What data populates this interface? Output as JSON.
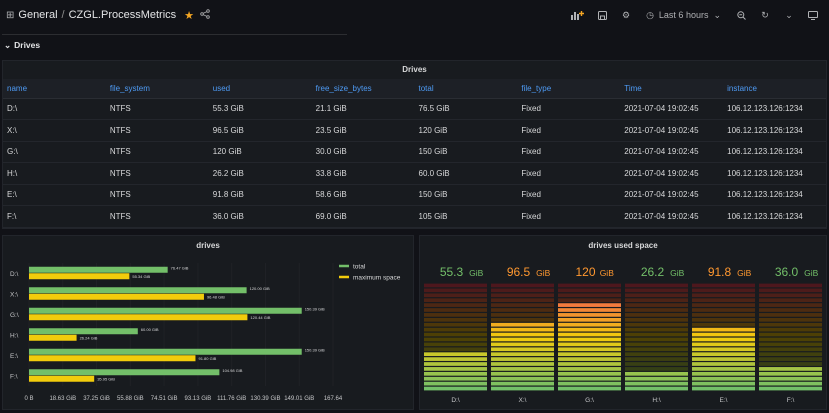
{
  "header": {
    "folder": "General",
    "separator": "/",
    "dashboard": "CZGL.ProcessMetrics",
    "time_range": "Last 6 hours"
  },
  "row": {
    "title": "Drives"
  },
  "table": {
    "title": "Drives",
    "columns": [
      "name",
      "file_system",
      "used",
      "free_size_bytes",
      "total",
      "file_type",
      "Time",
      "instance"
    ],
    "rows": [
      [
        "D:\\",
        "NTFS",
        "55.3 GiB",
        "21.1 GiB",
        "76.5 GiB",
        "Fixed",
        "2021-07-04 19:02:45",
        "106.12.123.126:1234"
      ],
      [
        "X:\\",
        "NTFS",
        "96.5 GiB",
        "23.5 GiB",
        "120 GiB",
        "Fixed",
        "2021-07-04 19:02:45",
        "106.12.123.126:1234"
      ],
      [
        "G:\\",
        "NTFS",
        "120 GiB",
        "30.0 GiB",
        "150 GiB",
        "Fixed",
        "2021-07-04 19:02:45",
        "106.12.123.126:1234"
      ],
      [
        "H:\\",
        "NTFS",
        "26.2 GiB",
        "33.8 GiB",
        "60.0 GiB",
        "Fixed",
        "2021-07-04 19:02:45",
        "106.12.123.126:1234"
      ],
      [
        "E:\\",
        "NTFS",
        "91.8 GiB",
        "58.6 GiB",
        "150 GiB",
        "Fixed",
        "2021-07-04 19:02:45",
        "106.12.123.126:1234"
      ],
      [
        "F:\\",
        "NTFS",
        "36.0 GiB",
        "69.0 GiB",
        "105 GiB",
        "Fixed",
        "2021-07-04 19:02:45",
        "106.12.123.126:1234"
      ]
    ]
  },
  "chart_data": [
    {
      "type": "bar",
      "orientation": "horizontal",
      "title": "drives",
      "categories": [
        "D:\\",
        "X:\\",
        "G:\\",
        "H:\\",
        "E:\\",
        "F:\\"
      ],
      "series": [
        {
          "name": "total",
          "color": "#73bf69",
          "values": [
            76.47,
            120.0,
            150.39,
            60.0,
            150.39,
            104.98
          ],
          "labels": [
            "76.47 GiB",
            "120.00 GiB",
            "150.39 GiB",
            "60.00 GiB",
            "150.39 GiB",
            "104.98 GiB"
          ]
        },
        {
          "name": "maximum space",
          "color": "#f2cc0c",
          "values": [
            55.34,
            96.48,
            120.44,
            26.24,
            91.8,
            35.95
          ],
          "labels": [
            "55.34 GiB",
            "96.48 GiB",
            "120.44 GiB",
            "26.24 GiB",
            "91.80 GiB",
            "35.95 GiB"
          ]
        }
      ],
      "xlim": [
        0,
        167.64
      ],
      "xticks": [
        0,
        18.63,
        37.25,
        55.88,
        74.51,
        93.13,
        111.76,
        130.39,
        149.01,
        167.64
      ],
      "xtick_labels": [
        "0 B",
        "18.63 GiB",
        "37.25 GiB",
        "55.88 GiB",
        "74.51 GiB",
        "93.13 GiB",
        "111.76 GiB",
        "130.39 GiB",
        "149.01 GiB",
        "167.64"
      ],
      "legend_position": "top-right"
    },
    {
      "type": "bar",
      "style": "bar-gauge-retro-lcd",
      "title": "drives used space",
      "categories": [
        "D:\\",
        "X:\\",
        "G:\\",
        "H:\\",
        "E:\\",
        "F:\\"
      ],
      "values": [
        55.3,
        96.5,
        120,
        26.2,
        91.8,
        36.0
      ],
      "value_labels": [
        "55.3",
        "96.5",
        "120",
        "26.2",
        "91.8",
        "36.0"
      ],
      "unit": "GiB",
      "value_colors": [
        "#73bf69",
        "#ff9830",
        "#ff9830",
        "#73bf69",
        "#ff9830",
        "#73bf69"
      ],
      "max": 150
    }
  ]
}
